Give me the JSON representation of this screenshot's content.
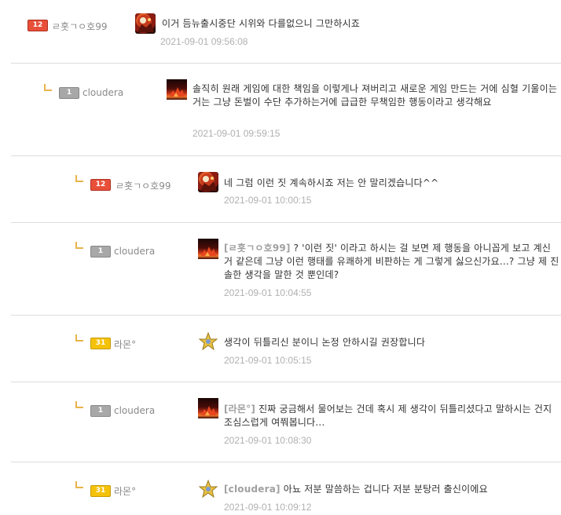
{
  "comments": [
    {
      "level": "12",
      "nickname": "ㄹ홋ㄱㅇ호99",
      "mention": "",
      "text": "이거 듬뉴출시중단 시위와 다를없으니 그만하시죠",
      "time": "2021-09-01 09:56:08"
    },
    {
      "level": "1",
      "nickname": "cloudera",
      "mention": "",
      "text": "솔직히 원래 게임에 대한 책임을 이렇게나 져버리고 새로운 게임 만드는 거에 심혈 기울이는 거는 그냥 돈벌이 수단 추가하는거에 급급한 무책임한 행동이라고 생각해요",
      "time": "2021-09-01 09:59:15"
    },
    {
      "level": "12",
      "nickname": "ㄹ홋ㄱㅇ호99",
      "mention": "",
      "text": "네 그럼 이런 짓 계속하시죠 저는 안 말리겠습니다^^",
      "time": "2021-09-01 10:00:15"
    },
    {
      "level": "1",
      "nickname": "cloudera",
      "mention": "[ㄹ홋ㄱㅇ호99]",
      "text": "? '이런 짓' 이라고 하시는 걸 보면 제 행동을 아니꼽게 보고 계신 거 같은데 그냥 이런 행태를 유쾌하게 비판하는 게 그렇게 싫으신가요...? 그냥 제 진솔한 생각을 말한 것 뿐인데?",
      "time": "2021-09-01 10:04:55"
    },
    {
      "level": "31",
      "nickname": "라몬°",
      "mention": "",
      "text": "생각이 뒤틀리신 분이니 논정 안하시길 권장합니다",
      "time": "2021-09-01 10:05:15"
    },
    {
      "level": "1",
      "nickname": "cloudera",
      "mention": "[라몬°]",
      "text": "진짜 궁금해서 물어보는 건데 혹시 제 생각이 뒤틀리셨다고 말하시는 건지 조심스럽게 여쭤봅니다...",
      "time": "2021-09-01 10:08:30"
    },
    {
      "level": "31",
      "nickname": "라몬°",
      "mention": "[cloudera]",
      "text": "아뇨 저분 말씀하는 겁니다 저분 분탕러 출신이에요",
      "time": "2021-09-01 10:09:12"
    }
  ],
  "colors": {
    "level_red": "#e8503a",
    "level_gray": "#a8a8a8",
    "level_yellow": "#f5c20a",
    "reply_marker": "#e8b44a"
  }
}
